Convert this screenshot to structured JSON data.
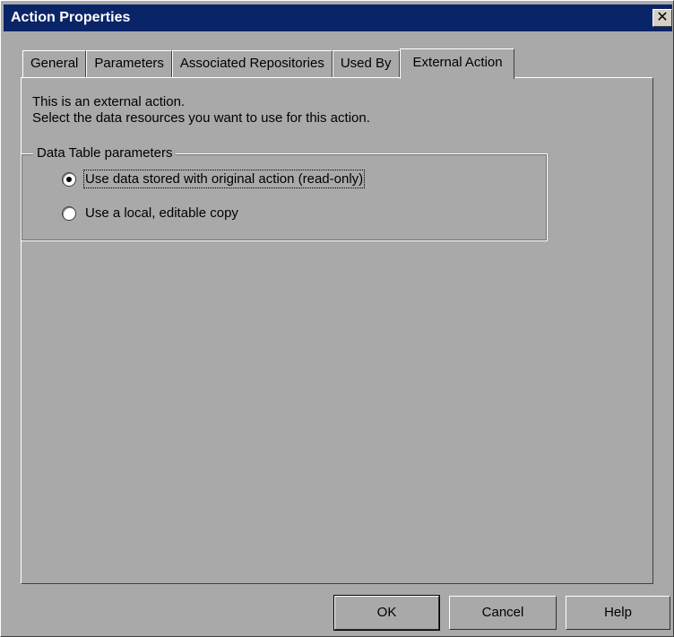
{
  "window": {
    "title": "Action Properties",
    "close_glyph": "✕"
  },
  "tabs": [
    {
      "label": "General"
    },
    {
      "label": "Parameters"
    },
    {
      "label": "Associated Repositories"
    },
    {
      "label": "Used By"
    },
    {
      "label": "External Action"
    }
  ],
  "active_tab": "External Action",
  "panel": {
    "line1": "This is an external action.",
    "line2": "Select the data resources you want to use for this action.",
    "group_title": "Data Table parameters",
    "options": [
      {
        "label": "Use data stored with original action (read-only)",
        "checked": true
      },
      {
        "label": "Use a local, editable copy",
        "checked": false
      }
    ]
  },
  "buttons": {
    "ok": "OK",
    "cancel": "Cancel",
    "help": "Help"
  },
  "colors": {
    "title_bar": "#0a2468",
    "dialog_bg": "#a9a9a9"
  }
}
